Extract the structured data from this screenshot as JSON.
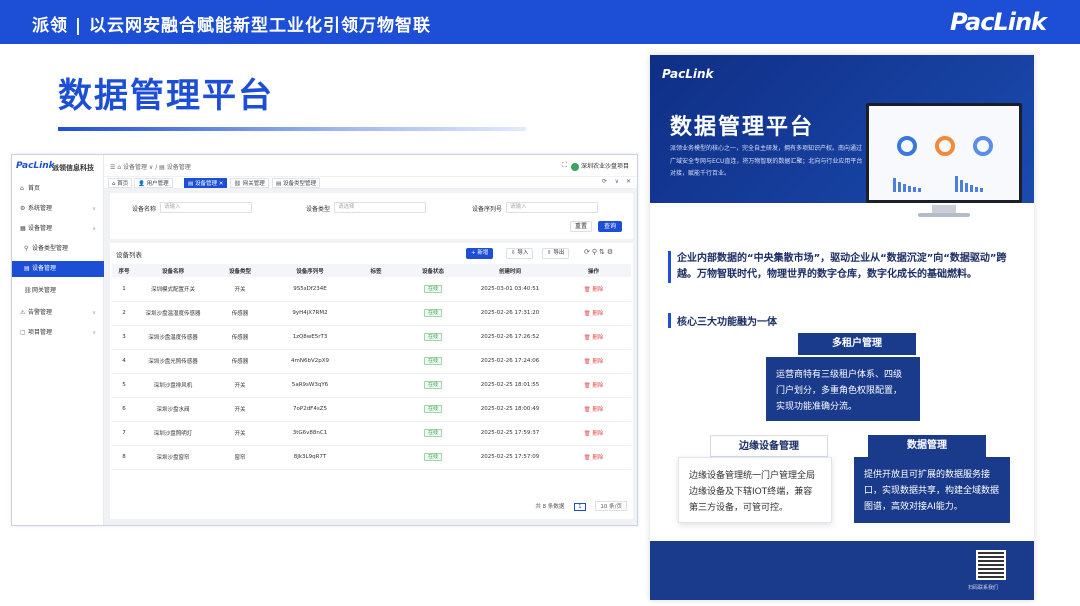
{
  "header": {
    "slogan": "派领 | 以云网安融合赋能新型工业化引领万物智联",
    "brand": "PacLink"
  },
  "page_title": "数据管理平台",
  "app": {
    "logo": "PacLink",
    "company": "派领信息科技",
    "breadcrumb": "☰  ⌂ 设备管理 ∨ / ▤ 设备管理",
    "user": "深圳农业沙盘项目",
    "sidebar": [
      {
        "icon": "⌂",
        "label": "首页",
        "arrow": ""
      },
      {
        "icon": "⚙",
        "label": "系统管理",
        "arrow": "∨"
      },
      {
        "icon": "▦",
        "label": "设备管理",
        "arrow": "∧"
      },
      {
        "icon": "⚲",
        "label": "设备类型管理",
        "arrow": ""
      },
      {
        "icon": "▤",
        "label": "设备管理",
        "arrow": ""
      },
      {
        "icon": "⛓",
        "label": "网关管理",
        "arrow": ""
      },
      {
        "icon": "⚠",
        "label": "告警管理",
        "arrow": "∨"
      },
      {
        "icon": "▢",
        "label": "项目管理",
        "arrow": "∨"
      }
    ],
    "tabs": [
      "⌂ 首页",
      "👤 用户管理",
      "▤ 设备管理 ✕",
      "⛓ 网关管理",
      "▤ 设备类型管理"
    ],
    "filters": {
      "name_label": "设备名称",
      "name_placeholder": "请输入",
      "type_label": "设备类型",
      "type_placeholder": "请选择",
      "serial_label": "设备序列号",
      "serial_placeholder": "请输入",
      "reset": "重置",
      "search": "查询"
    },
    "list": {
      "title": "设备列表",
      "add": "+ 新增",
      "import": "⇩ 导入",
      "export": "⇧ 导出",
      "columns": [
        "序号",
        "设备名称",
        "设备类型",
        "设备序列号",
        "标签",
        "设备状态",
        "创建时间",
        "操作"
      ],
      "rows": [
        {
          "no": "1",
          "name": "深圳模式配置开关",
          "type": "开关",
          "serial": "9S5sDf234E",
          "tag": "",
          "status": "在线",
          "time": "2025-03-01 03:40:51",
          "op": "🗑 删除"
        },
        {
          "no": "2",
          "name": "深圳沙盘温湿度传感器",
          "type": "传感器",
          "serial": "9yH4jX7RM2",
          "tag": "",
          "status": "在线",
          "time": "2025-02-26 17:31:20",
          "op": "🗑 删除"
        },
        {
          "no": "3",
          "name": "深圳沙盘温度传感器",
          "type": "传感器",
          "serial": "1zQ8wE5rT3",
          "tag": "",
          "status": "在线",
          "time": "2025-02-26 17:26:52",
          "op": "🗑 删除"
        },
        {
          "no": "4",
          "name": "深圳沙盘光照传感器",
          "type": "传感器",
          "serial": "4mN6bV2pX9",
          "tag": "",
          "status": "在线",
          "time": "2025-02-26 17:24:06",
          "op": "🗑 删除"
        },
        {
          "no": "5",
          "name": "深圳沙盘排风机",
          "type": "开关",
          "serial": "5aR9sW3qY6",
          "tag": "",
          "status": "在线",
          "time": "2025-02-25 18:01:55",
          "op": "🗑 删除"
        },
        {
          "no": "6",
          "name": "深圳沙盘水阀",
          "type": "开关",
          "serial": "7oP2dF4sZ5",
          "tag": "",
          "status": "在线",
          "time": "2025-02-25 18:00:49",
          "op": "🗑 删除"
        },
        {
          "no": "7",
          "name": "深圳沙盘照明灯",
          "type": "开关",
          "serial": "3tG6v88nC1",
          "tag": "",
          "status": "在线",
          "time": "2025-02-25 17:59:37",
          "op": "🗑 删除"
        },
        {
          "no": "8",
          "name": "深圳沙盘窗帘",
          "type": "窗帘",
          "serial": "8Jk3L9qR7T",
          "tag": "",
          "status": "在线",
          "time": "2025-02-25 17:57:09",
          "op": "🗑 删除"
        }
      ],
      "total": "共 8 条数据",
      "page": "1",
      "page_size": "10 条/页"
    }
  },
  "poster": {
    "brand": "PacLink",
    "title": "数据管理平台",
    "desc": "派领业务模型的核心之一，完全自主研发，拥有多项知识产权。南向通过广域安全专网与ECU直连，将万物智联的数据汇聚；北向与行业应用平台对接，赋能千行百业。",
    "intro": "企业内部数据的“中央集散市场”，驱动企业从“数据沉淀”向“数据驱动”跨越。万物智联时代，物理世界的数字仓库，数字化成长的基础燃料。",
    "core": "核心三大功能融为一体",
    "features": [
      {
        "title": "多租户管理",
        "text": "运营商特有三级租户体系、四级门户划分，多重角色权限配置，实现功能准确分流。"
      },
      {
        "title": "边缘设备管理",
        "text": "边缘设备管理统一门户管理全局边缘设备及下辖IOT终端，兼容第三方设备，可管可控。"
      },
      {
        "title": "数据管理",
        "text": "提供开放且可扩展的数据服务接口，实现数据共享，构建全域数据图谱，高效对接AI能力。"
      }
    ],
    "qr_text": "扫码联系我们"
  }
}
